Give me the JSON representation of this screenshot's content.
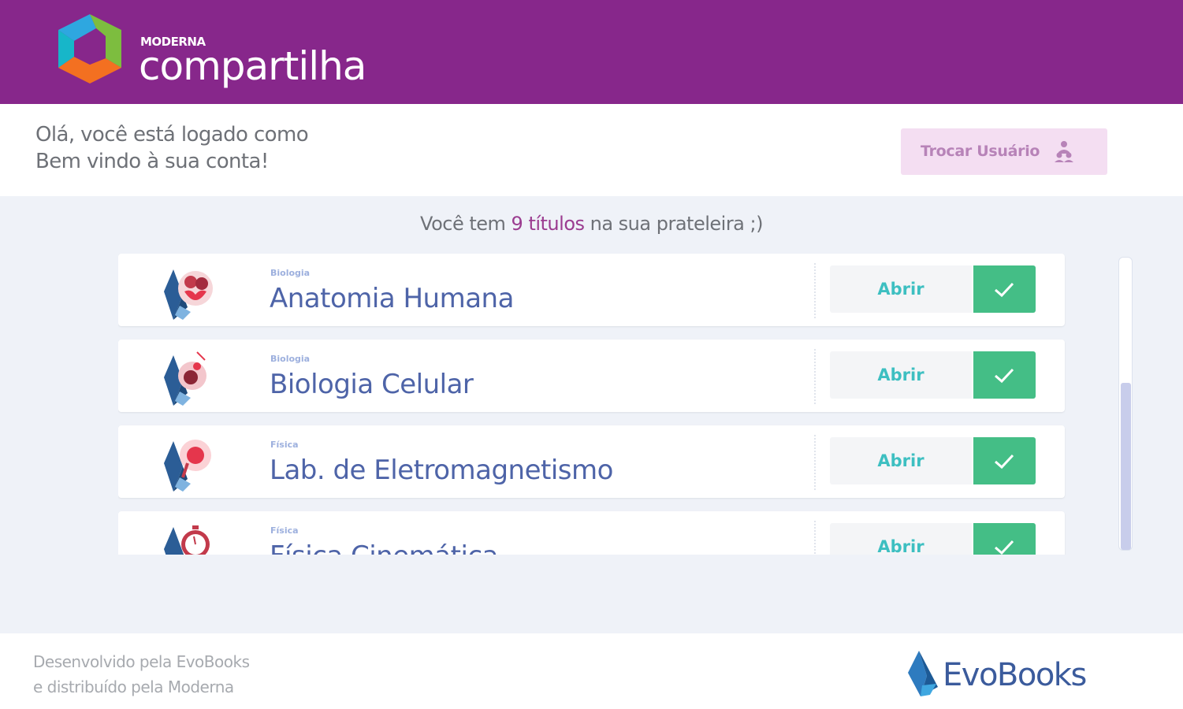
{
  "header": {
    "brand_small": "MODERNA",
    "brand_big": "compartilha",
    "colors": {
      "background": "#87278b"
    }
  },
  "user_bar": {
    "greeting_line1": "Olá, você está logado como",
    "greeting_line2": "Bem vindo à sua conta!",
    "switch_user_label": "Trocar Usuário",
    "switch_user_icon": "users-icon"
  },
  "shelf": {
    "count_prefix": "Você tem ",
    "count_highlight": "9 títulos",
    "count_suffix": " na sua prateleira ;)",
    "items": [
      {
        "subject": "Biologia",
        "title": "Anatomia Humana",
        "open_label": "Abrir",
        "icon": "heart-book-icon"
      },
      {
        "subject": "Biologia",
        "title": "Biologia Celular",
        "open_label": "Abrir",
        "icon": "cell-book-icon"
      },
      {
        "subject": "Física",
        "title": "Lab. de Eletromagnetismo",
        "open_label": "Abrir",
        "icon": "magnet-book-icon"
      },
      {
        "subject": "Física",
        "title": "Física Cinemática",
        "open_label": "Abrir",
        "icon": "stopwatch-book-icon"
      }
    ],
    "colors": {
      "title": "#4e64a8",
      "open": "#3dbfc1",
      "check": "#44be86",
      "highlight": "#9b3c90"
    }
  },
  "footer": {
    "credit_line1": "Desenvolvido pela EvoBooks",
    "credit_line2": "e distribuído pela Moderna",
    "evobooks_logo_text": "EvoBooks"
  }
}
